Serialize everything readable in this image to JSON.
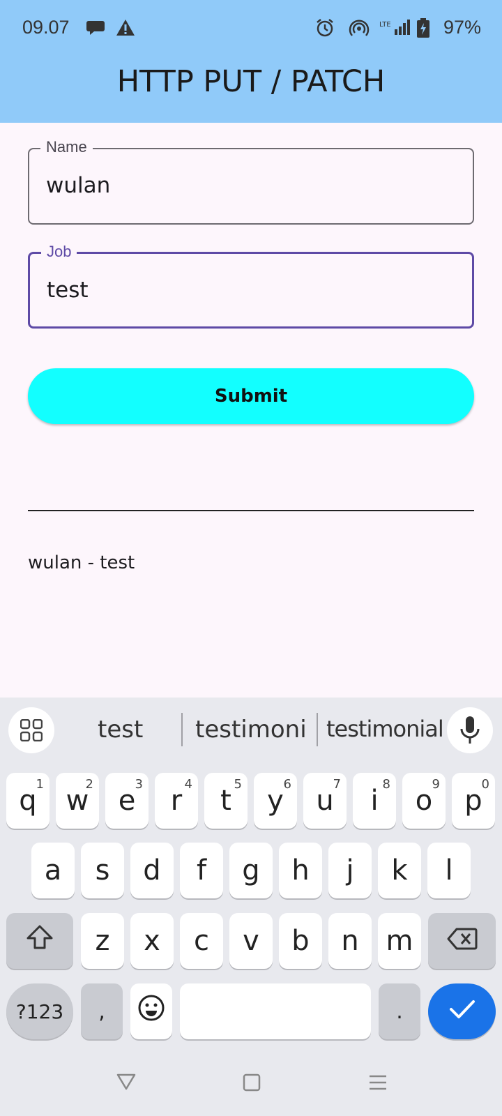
{
  "status_bar": {
    "time": "09.07",
    "network": "LTE",
    "battery": "97%"
  },
  "app_bar": {
    "title": "HTTP PUT / PATCH"
  },
  "form": {
    "name_label": "Name",
    "name_value": "wulan",
    "job_label": "Job",
    "job_value": "test",
    "submit_label": "Submit"
  },
  "result_text": "wulan - test",
  "colors": {
    "app_bar": "#90caf9",
    "submit": "#12ffff",
    "focus": "#5e4aa6",
    "confirm": "#1a73e8"
  },
  "keyboard": {
    "suggestions": [
      "test",
      "testimoni",
      "testimonial"
    ],
    "row1": [
      {
        "key": "q",
        "hint": "1"
      },
      {
        "key": "w",
        "hint": "2"
      },
      {
        "key": "e",
        "hint": "3"
      },
      {
        "key": "r",
        "hint": "4"
      },
      {
        "key": "t",
        "hint": "5"
      },
      {
        "key": "y",
        "hint": "6"
      },
      {
        "key": "u",
        "hint": "7"
      },
      {
        "key": "i",
        "hint": "8"
      },
      {
        "key": "o",
        "hint": "9"
      },
      {
        "key": "p",
        "hint": "0"
      }
    ],
    "row2": [
      "a",
      "s",
      "d",
      "f",
      "g",
      "h",
      "j",
      "k",
      "l"
    ],
    "row3": [
      "z",
      "x",
      "c",
      "v",
      "b",
      "n",
      "m"
    ],
    "symbols_label": "?123",
    "comma": ",",
    "period": "."
  },
  "icons": {
    "status": [
      "chat-bubble-icon",
      "warning-icon",
      "alarm-icon",
      "hotspot-icon",
      "signal-icon",
      "battery-charging-icon"
    ],
    "keyboard": [
      "apps-grid-icon",
      "microphone-icon",
      "shift-icon",
      "backspace-icon",
      "emoji-icon",
      "checkmark-icon"
    ],
    "navigation": [
      "back-icon",
      "home-icon",
      "recents-icon"
    ]
  }
}
